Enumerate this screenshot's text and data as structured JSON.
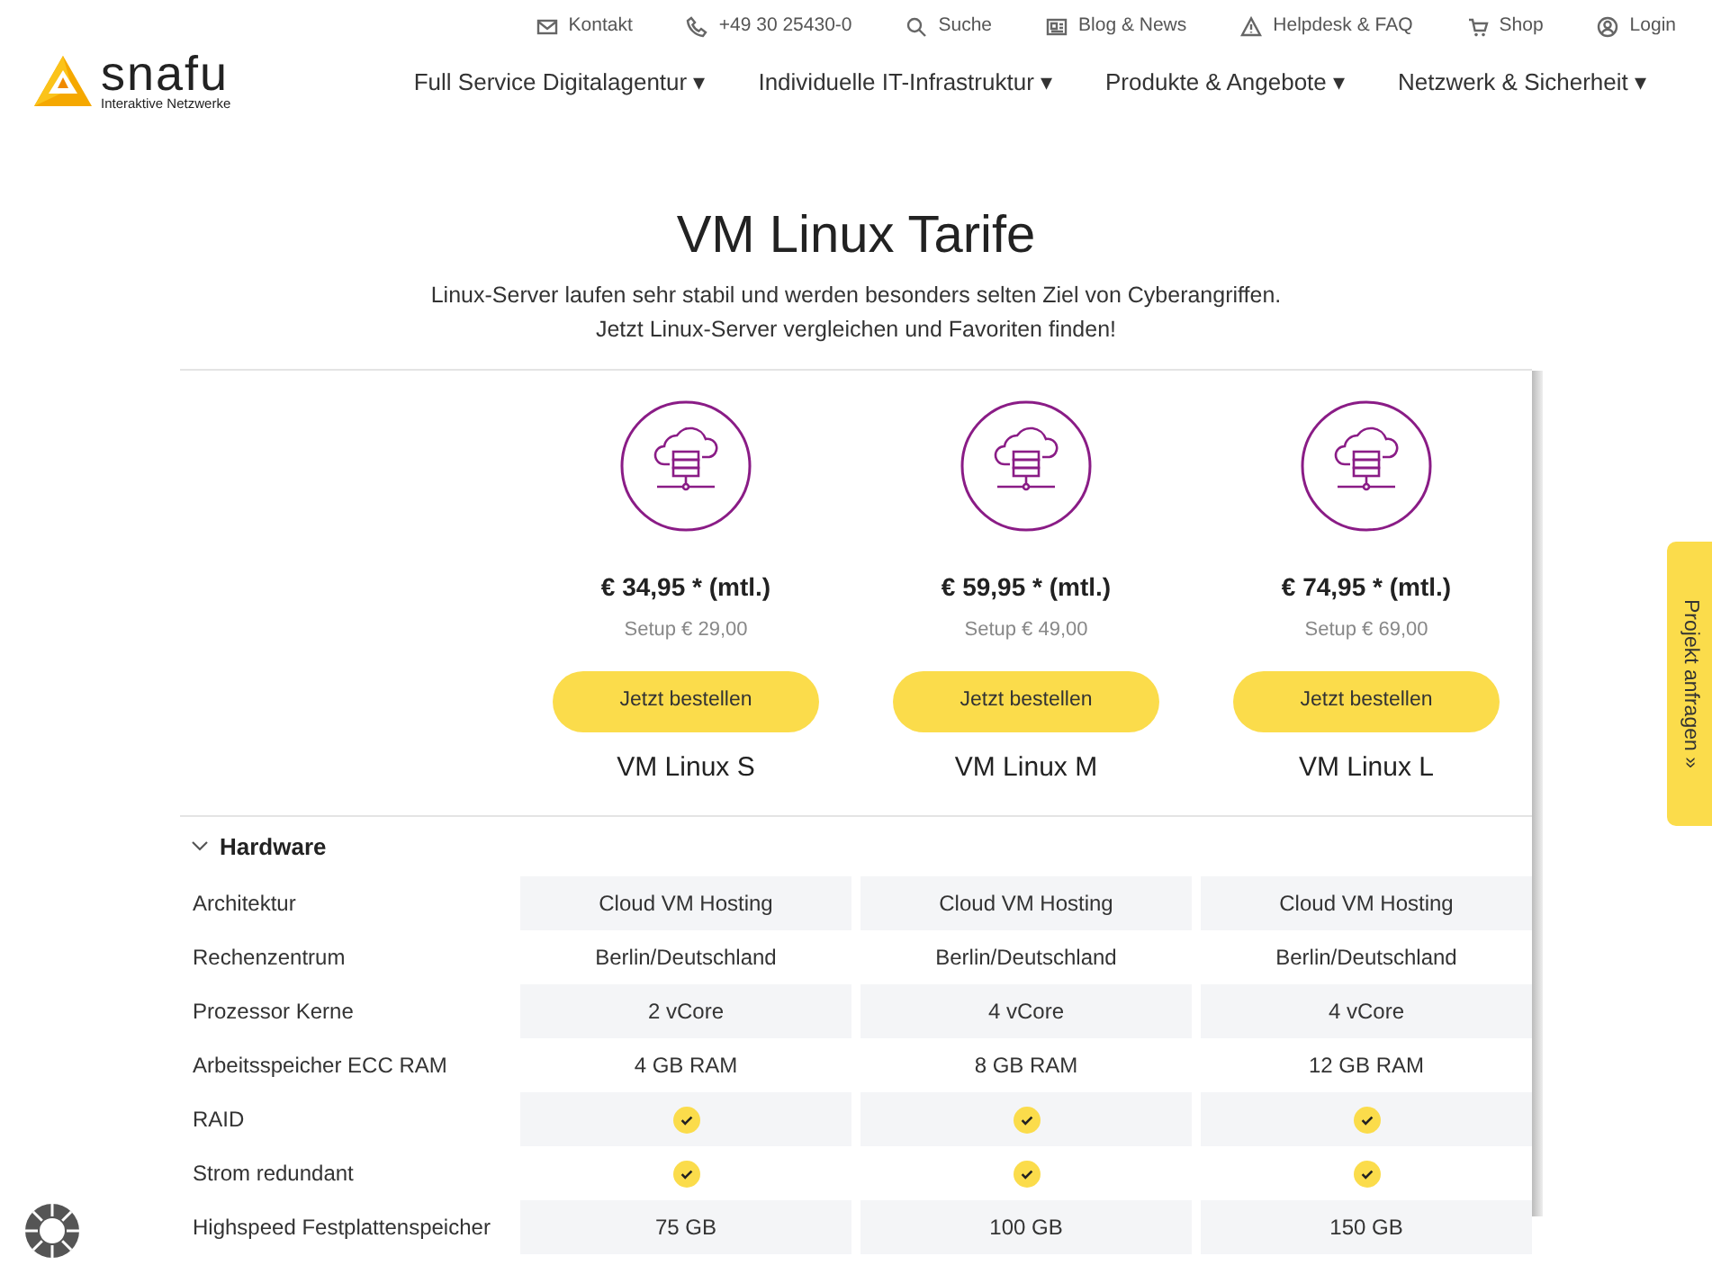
{
  "top_links": [
    {
      "label": "Kontakt"
    },
    {
      "label": "+49 30 25430-0"
    },
    {
      "label": "Suche"
    },
    {
      "label": "Blog & News"
    },
    {
      "label": "Helpdesk & FAQ"
    },
    {
      "label": "Shop"
    },
    {
      "label": "Login"
    }
  ],
  "logo": {
    "name": "snafu",
    "tagline": "Interaktive Netzwerke"
  },
  "nav": [
    {
      "label": "Full Service Digitalagentur ▾"
    },
    {
      "label": "Individuelle IT-Infrastruktur ▾"
    },
    {
      "label": "Produkte & Angebote ▾"
    },
    {
      "label": "Netzwerk & Sicherheit ▾"
    }
  ],
  "title": "VM Linux Tarife",
  "subtitle": [
    "Linux-Server laufen sehr stabil und werden besonders selten Ziel von Cyberangriffen.",
    "Jetzt Linux-Server vergleichen und Favoriten finden!"
  ],
  "plans": [
    {
      "price": "€ 34,95 * (mtl.)",
      "setup": "Setup € 29,00",
      "button": "Jetzt bestellen",
      "name": "VM Linux S"
    },
    {
      "price": "€ 59,95 * (mtl.)",
      "setup": "Setup € 49,00",
      "button": "Jetzt bestellen",
      "name": "VM Linux M"
    },
    {
      "price": "€ 74,95 * (mtl.)",
      "setup": "Setup € 69,00",
      "button": "Jetzt bestellen",
      "name": "VM Linux L"
    }
  ],
  "sections": [
    {
      "title": "Hardware",
      "expanded": true,
      "rows": [
        {
          "label": "Architektur",
          "cells": [
            {
              "kind": "text",
              "text": "Cloud VM Hosting"
            },
            {
              "kind": "text",
              "text": "Cloud VM Hosting"
            },
            {
              "kind": "text",
              "text": "Cloud VM Hosting"
            }
          ]
        },
        {
          "label": "Rechenzentrum",
          "cells": [
            {
              "kind": "text",
              "text": "Berlin/Deutschland"
            },
            {
              "kind": "text",
              "text": "Berlin/Deutschland"
            },
            {
              "kind": "text",
              "text": "Berlin/Deutschland"
            }
          ]
        },
        {
          "label": "Prozessor Kerne",
          "cells": [
            {
              "kind": "text",
              "text": "2 vCore"
            },
            {
              "kind": "text",
              "text": "4 vCore"
            },
            {
              "kind": "text",
              "text": "4 vCore"
            }
          ]
        },
        {
          "label": "Arbeitsspeicher ECC RAM",
          "cells": [
            {
              "kind": "text",
              "text": "4 GB RAM"
            },
            {
              "kind": "text",
              "text": "8 GB RAM"
            },
            {
              "kind": "text",
              "text": "12 GB RAM"
            }
          ]
        },
        {
          "label": "RAID",
          "cells": [
            {
              "kind": "check",
              "checked": true
            },
            {
              "kind": "check",
              "checked": true
            },
            {
              "kind": "check",
              "checked": true
            }
          ]
        },
        {
          "label": "Strom redundant",
          "cells": [
            {
              "kind": "check",
              "checked": true
            },
            {
              "kind": "check",
              "checked": true
            },
            {
              "kind": "check",
              "checked": true
            }
          ]
        },
        {
          "label": "Highspeed Festplattenspeicher",
          "cells": [
            {
              "kind": "text",
              "text": "75 GB"
            },
            {
              "kind": "text",
              "text": "100 GB"
            },
            {
              "kind": "text",
              "text": "150 GB"
            }
          ]
        }
      ]
    }
  ],
  "side_tab": {
    "label": "Projekt anfragen »"
  }
}
